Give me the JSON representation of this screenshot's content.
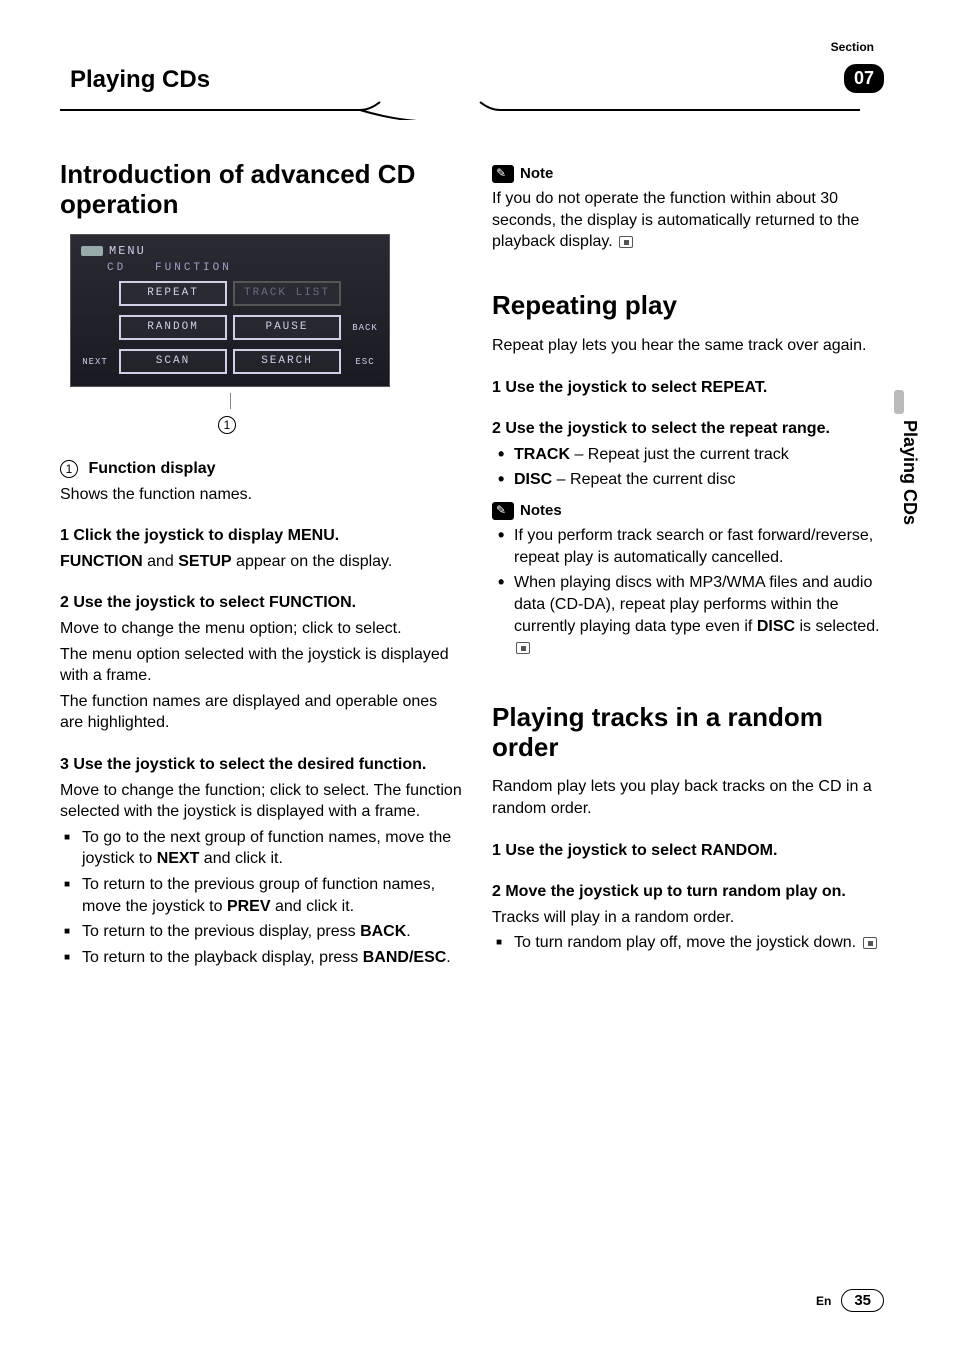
{
  "header": {
    "section_label": "Section",
    "chapter_title": "Playing CDs",
    "section_number": "07"
  },
  "side_tab": "Playing CDs",
  "footer": {
    "lang": "En",
    "page": "35"
  },
  "lcd": {
    "title": "MENU",
    "subtitle_prefix": "CD",
    "subtitle": "FUNCTION",
    "buttons": {
      "r1c1": "REPEAT",
      "r1c2": "TRACK LIST",
      "r2c1": "RANDOM",
      "r2c2": "PAUSE",
      "r3c1": "SCAN",
      "r3c2": "SEARCH"
    },
    "side": {
      "next": "NEXT",
      "back": "BACK",
      "esc": "ESC"
    },
    "callout_num": "1"
  },
  "left": {
    "h1": "Introduction of advanced CD operation",
    "callout": {
      "num": "1",
      "title": "Function display",
      "desc": "Shows the function names."
    },
    "step1_lead": "1   Click the joystick to display MENU.",
    "step1_body_a": "FUNCTION",
    "step1_body_mid": " and ",
    "step1_body_b": "SETUP",
    "step1_body_end": " appear on the display.",
    "step2_lead": "2   Use the joystick to select FUNCTION.",
    "step2_p1": "Move to change the menu option; click to select.",
    "step2_p2": "The menu option selected with the joystick is displayed with a frame.",
    "step2_p3": "The function names are displayed and operable ones are highlighted.",
    "step3_lead": "3   Use the joystick to select the desired function.",
    "step3_p1": "Move to change the function; click to select. The function selected with the joystick is displayed with a frame.",
    "b1_a": "To go to the next group of function names, move the joystick to ",
    "b1_b": "NEXT",
    "b1_c": " and click it.",
    "b2_a": "To return to the previous group of function names, move the joystick to ",
    "b2_b": "PREV",
    "b2_c": " and click it.",
    "b3_a": "To return to the previous display, press ",
    "b3_b": "BACK",
    "b3_c": ".",
    "b4_a": "To return to the playback display, press ",
    "b4_b": "BAND/ESC",
    "b4_c": "."
  },
  "right": {
    "note_label": "Note",
    "note_text": "If you do not operate the function within about 30 seconds, the display is automatically returned to the playback display.",
    "h1_repeat": "Repeating play",
    "repeat_intro": "Repeat play lets you hear the same track over again.",
    "r_step1": "1   Use the joystick to select REPEAT.",
    "r_step2": "2   Use the joystick to select the repeat range.",
    "range_track_b": "TRACK",
    "range_track_t": " – Repeat just the current track",
    "range_disc_b": "DISC",
    "range_disc_t": " – Repeat the current disc",
    "notes_label": "Notes",
    "notes_1": "If you perform track search or fast forward/reverse, repeat play is automatically cancelled.",
    "notes_2_a": "When playing discs with MP3/WMA files and audio data (CD-DA), repeat play performs within the currently playing data type even if ",
    "notes_2_b": "DISC",
    "notes_2_c": " is selected.",
    "h1_random": "Playing tracks in a random order",
    "random_intro": "Random play lets you play back tracks on the CD in a random order.",
    "rnd_step1": "1   Use the joystick to select RANDOM.",
    "rnd_step2": "2   Move the joystick up to turn random play on.",
    "rnd_p": "Tracks will play in a random order.",
    "rnd_b1": "To turn random play off, move the joystick down."
  }
}
